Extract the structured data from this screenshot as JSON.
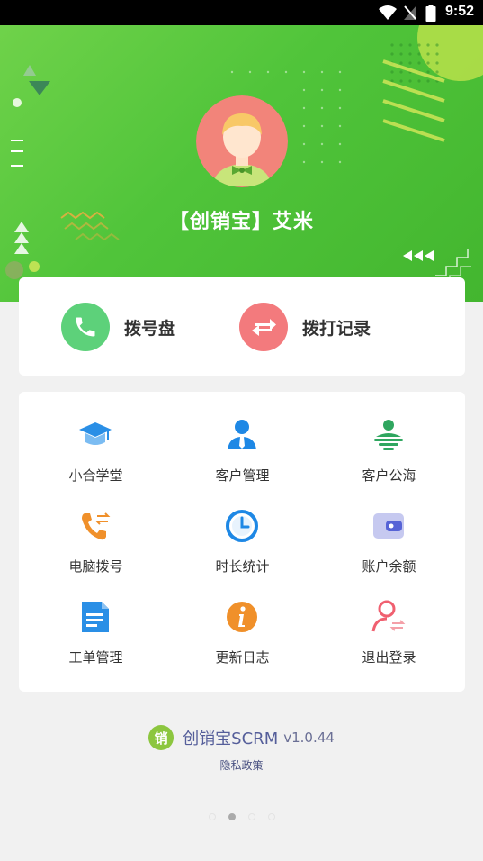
{
  "status_bar": {
    "time": "9:52"
  },
  "profile": {
    "name": "【创销宝】艾米"
  },
  "quick_actions": [
    {
      "label": "拨号盘",
      "icon": "phone-icon",
      "color": "#5dd17a"
    },
    {
      "label": "拨打记录",
      "icon": "swap-arrows-icon",
      "color": "#f37a7d"
    }
  ],
  "menu": [
    {
      "label": "小合学堂",
      "icon": "graduation-cap-icon"
    },
    {
      "label": "客户管理",
      "icon": "person-tie-icon"
    },
    {
      "label": "客户公海",
      "icon": "person-sea-icon"
    },
    {
      "label": "电脑拨号",
      "icon": "phone-transfer-icon"
    },
    {
      "label": "时长统计",
      "icon": "clock-icon"
    },
    {
      "label": "账户余额",
      "icon": "wallet-icon"
    },
    {
      "label": "工单管理",
      "icon": "document-icon"
    },
    {
      "label": "更新日志",
      "icon": "info-icon"
    },
    {
      "label": "退出登录",
      "icon": "logout-person-icon"
    }
  ],
  "footer": {
    "logo_char": "销",
    "brand": "创销宝SCRM",
    "version": "v1.0.44",
    "privacy": "隐私政策"
  },
  "colors": {
    "hero_green": "#50c43a",
    "accent_blue": "#2a8fe6",
    "accent_orange": "#f0902a",
    "accent_green": "#2fa65f",
    "accent_red": "#f06070"
  }
}
